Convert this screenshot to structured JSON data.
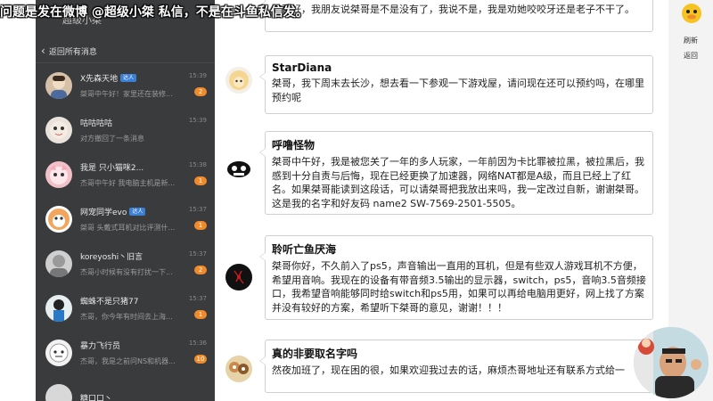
{
  "banner": "问题是发在微博 @超级小桀 私信，不是在斗鱼私信发。",
  "sidebar": {
    "top_title": "超级小桀",
    "back_label": "返回所有消息",
    "items": [
      {
        "name": "X先森天地",
        "tag": "达人",
        "preview": "桀哥中午好！家里还在装修...",
        "time": "15:39",
        "badge": "2"
      },
      {
        "name": "咕咕咕咕",
        "preview": "对方撤回了一条消息",
        "time": "15:39",
        "badge": ""
      },
      {
        "name": "我是 只小猫咪2...",
        "preview": "杰哥中午好 我电脑主机是新...",
        "time": "15:38",
        "badge": "1"
      },
      {
        "name": "网宠同学evo",
        "tag": "达人",
        "preview": "桀哥 头戴式耳机对比评测什...",
        "time": "15:37",
        "badge": "1"
      },
      {
        "name": "koreyoshi丶旧言",
        "preview": "杰哥小时候有没有打扰一下...",
        "time": "15:37",
        "badge": "2"
      },
      {
        "name": "蜘蛛不是只猪77",
        "preview": "杰哥，你今年有时间去上海...",
        "time": "15:37",
        "badge": "1"
      },
      {
        "name": "暴力飞行员",
        "preview": "杰哥，我是之前问NS和机器...",
        "time": "15:36",
        "badge": "10"
      },
      {
        "name": "糖口口丶",
        "preview": "",
        "time": "",
        "badge": ""
      }
    ]
  },
  "messages": [
    {
      "who": "",
      "body": "桀哥好，我朋友说桀哥是不是没有了，我说不是，我是劝她咬咬牙还是老子不干了。"
    },
    {
      "who": "StarDiana",
      "body": "桀哥，我下周末去长沙，想去看一下参观一下游戏屋，请问现在还可以预约吗，在哪里预约呢"
    },
    {
      "who": "呼噜怪物",
      "body": "桀哥中午好，我是被您关了一年的多人玩家，一年前因为卡比罪被拉黑，被拉黑后，我感到十分自责与后悔，现在已经更换了加速器，网络NAT都是A级，而且已经上了红名。如果桀哥能读到这段话，可以请桀哥把我放出来吗，我一定改过自新，谢谢桀哥。这是我的名字和好友码 name2 SW-7569-2501-5505。"
    },
    {
      "who": "聆听亡鱼厌海",
      "body": "桀哥你好，不久前入了ps5，声音输出一直用的耳机，但是有些双人游戏耳机不方便，希望用音响。我现在的设备有带音频3.5输出的显示器，switch，ps5，音响3.5音频接口，我希望音响能够同时给switch和ps5用，如果可以再给电脑用更好，网上找了方案并没有较好的方案，希望听下桀哥的意见，谢谢！！！"
    },
    {
      "who": "真的非要取名字吗",
      "body": "然夜加班了，现在困的很，如果欢迎我过去的话，麻烦杰哥地址还有联系方式给一"
    }
  ],
  "right_panel": {
    "refresh_label": "刷新",
    "back_label": "返回"
  }
}
